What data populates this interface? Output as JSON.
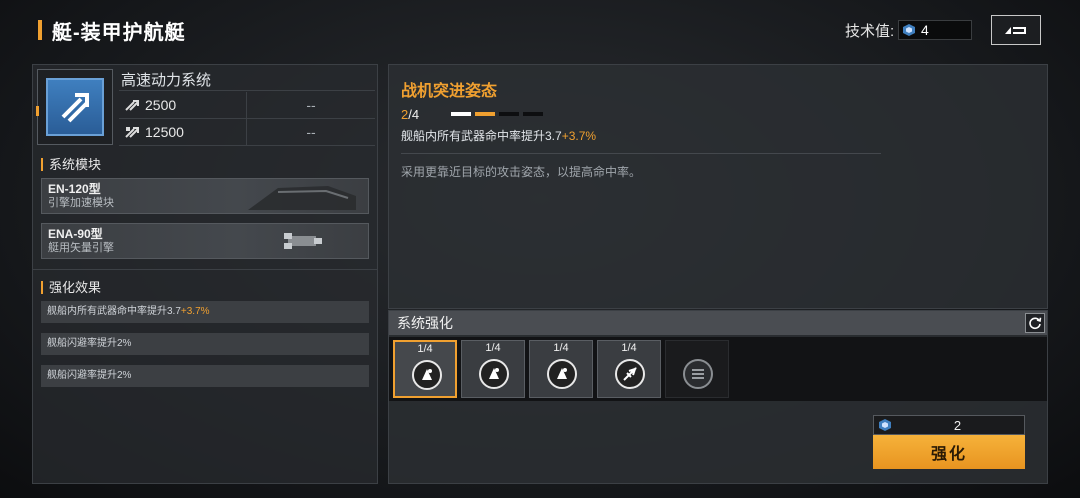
{
  "header": {
    "title": "艇-装甲护航艇",
    "tech_label": "技术值:",
    "tech_value": "4"
  },
  "system": {
    "name": "高速动力系统",
    "stats": [
      {
        "value": "2500",
        "extra": "--"
      },
      {
        "value": "12500",
        "extra": "--"
      }
    ]
  },
  "modules": {
    "heading": "系统模块",
    "items": [
      {
        "name": "EN-120型",
        "desc": "引擎加速模块"
      },
      {
        "name": "ENA-90型",
        "desc": "艇用矢量引擎"
      }
    ]
  },
  "effects": {
    "heading": "强化效果",
    "items": [
      {
        "text": "舰船内所有武器命中率提升3.7",
        "bonus": "+3.7%"
      },
      {
        "text": "舰船闪避率提升2%",
        "bonus": ""
      },
      {
        "text": "舰船闪避率提升2%",
        "bonus": ""
      }
    ]
  },
  "detail": {
    "title": "战机突进姿态",
    "level_current": "2",
    "level_max": "/4",
    "level_filled": 2,
    "level_total": 4,
    "effect_text": "舰船内所有武器命中率提升3.7",
    "effect_bonus": "+3.7%",
    "description": "采用更靠近目标的攻击姿态，以提高命中率。"
  },
  "enhance": {
    "heading": "系统强化",
    "slots": [
      {
        "level": "1/4",
        "icon": "bell-icon"
      },
      {
        "level": "1/4",
        "icon": "bell-icon"
      },
      {
        "level": "1/4",
        "icon": "bell-icon"
      },
      {
        "level": "1/4",
        "icon": "jet-icon"
      }
    ],
    "cost": "2",
    "button_label": "强化"
  },
  "colors": {
    "accent": "#f0a030",
    "tech_blue": "#3f7fbf"
  }
}
